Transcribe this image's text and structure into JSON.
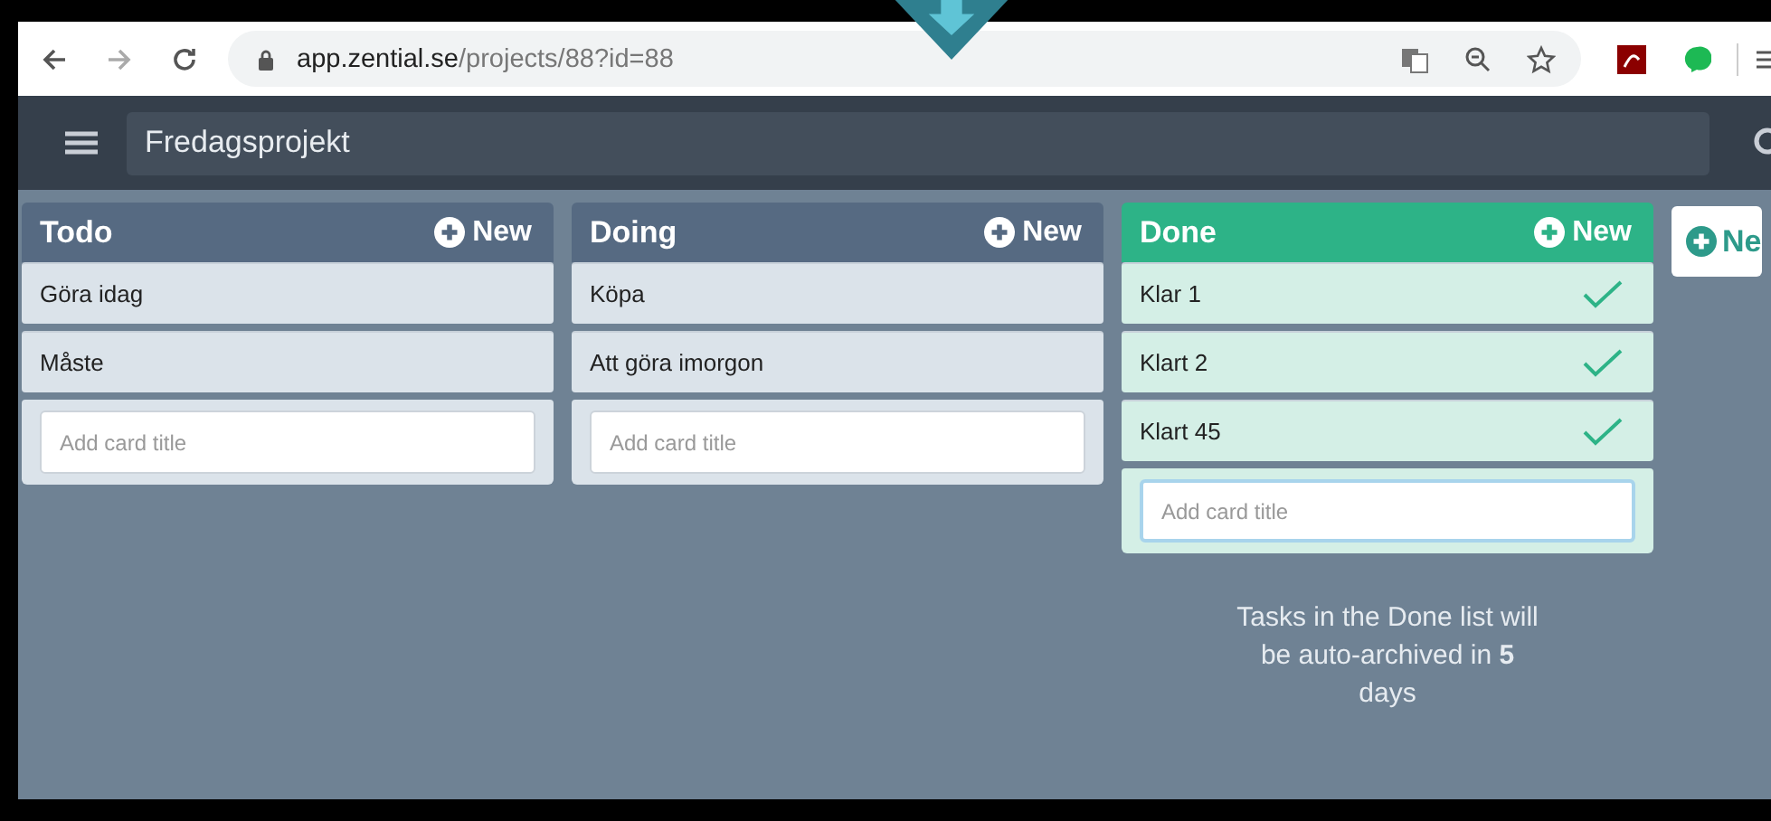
{
  "browser": {
    "url_host": "app.zential.se",
    "url_path": "/projects/88?id=88"
  },
  "header": {
    "project_title": "Fredagsprojekt"
  },
  "lists": [
    {
      "title": "Todo",
      "kind": "normal",
      "new_label": "New",
      "cards": [
        {
          "title": "Göra idag",
          "done": false
        },
        {
          "title": "Måste",
          "done": false
        }
      ],
      "input": {
        "placeholder": "Add card title",
        "focused": false
      }
    },
    {
      "title": "Doing",
      "kind": "normal",
      "new_label": "New",
      "cards": [
        {
          "title": "Köpa",
          "done": false
        },
        {
          "title": "Att göra imorgon",
          "done": false
        }
      ],
      "input": {
        "placeholder": "Add card title",
        "focused": false
      }
    },
    {
      "title": "Done",
      "kind": "done",
      "new_label": "New",
      "cards": [
        {
          "title": "Klar 1",
          "done": true
        },
        {
          "title": "Klart 2",
          "done": true
        },
        {
          "title": "Klart 45",
          "done": true
        }
      ],
      "input": {
        "placeholder": "Add card title",
        "focused": true
      },
      "note": "Tasks in the Done list will be auto-archived in **5** days"
    }
  ],
  "add_list_button": {
    "label": "Ne"
  }
}
